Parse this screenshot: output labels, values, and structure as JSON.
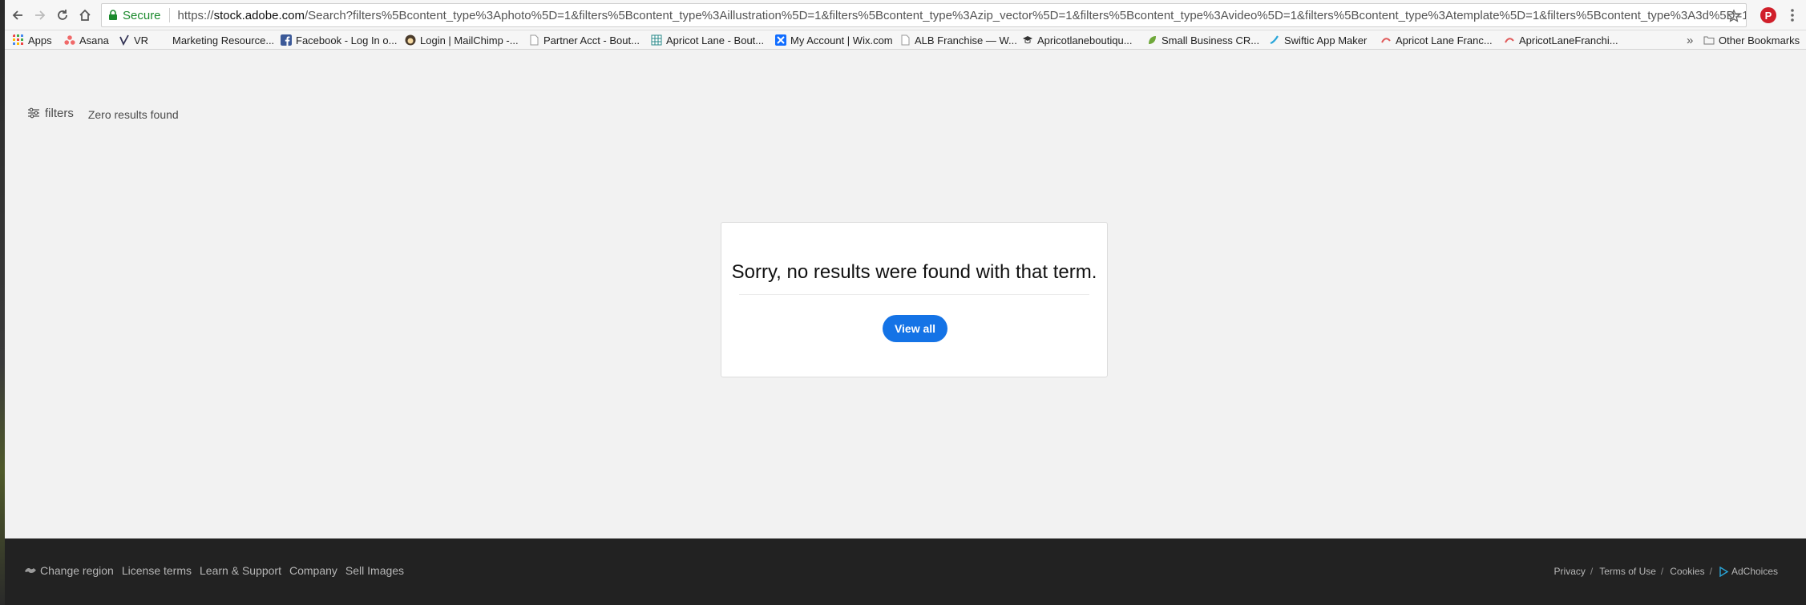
{
  "browser": {
    "secure_label": "Secure",
    "url_scheme": "https://",
    "url_host": "stock.adobe.com",
    "url_path": "/Search?filters%5Bcontent_type%3Aphoto%5D=1&filters%5Bcontent_type%3Aillustration%5D=1&filters%5Bcontent_type%3Azip_vector%5D=1&filters%5Bcontent_type%3Avideo%5D=1&filters%5Bcontent_type%3Atemplate%5D=1&filters%5Bcontent_type%3A3d%5D=1&filte..."
  },
  "bookmarks": {
    "items": [
      {
        "label": "Apps"
      },
      {
        "label": "Asana"
      },
      {
        "label": "VR"
      },
      {
        "label": "Marketing Resource..."
      },
      {
        "label": "Facebook - Log In o..."
      },
      {
        "label": "Login | MailChimp -..."
      },
      {
        "label": "Partner Acct - Bout..."
      },
      {
        "label": "Apricot Lane - Bout..."
      },
      {
        "label": "My Account | Wix.com"
      },
      {
        "label": "ALB Franchise — W..."
      },
      {
        "label": "Apricotlaneboutiqu..."
      },
      {
        "label": "Small Business CR..."
      },
      {
        "label": "Swiftic App Maker"
      },
      {
        "label": "Apricot Lane Franc..."
      },
      {
        "label": "ApricotLaneFranchi..."
      }
    ],
    "overflow": "»",
    "other_label": "Other Bookmarks"
  },
  "filters": {
    "label": "filters",
    "results_text": "Zero results found"
  },
  "no_results": {
    "message": "Sorry, no results were found with that term.",
    "button_label": "View all",
    "button_color": "#1473e6"
  },
  "footer": {
    "left_links": [
      "Change region",
      "License terms",
      "Learn & Support",
      "Company",
      "Sell Images"
    ],
    "right_links": [
      "Privacy",
      "Terms of Use",
      "Cookies",
      "AdChoices"
    ],
    "separator": "/"
  }
}
